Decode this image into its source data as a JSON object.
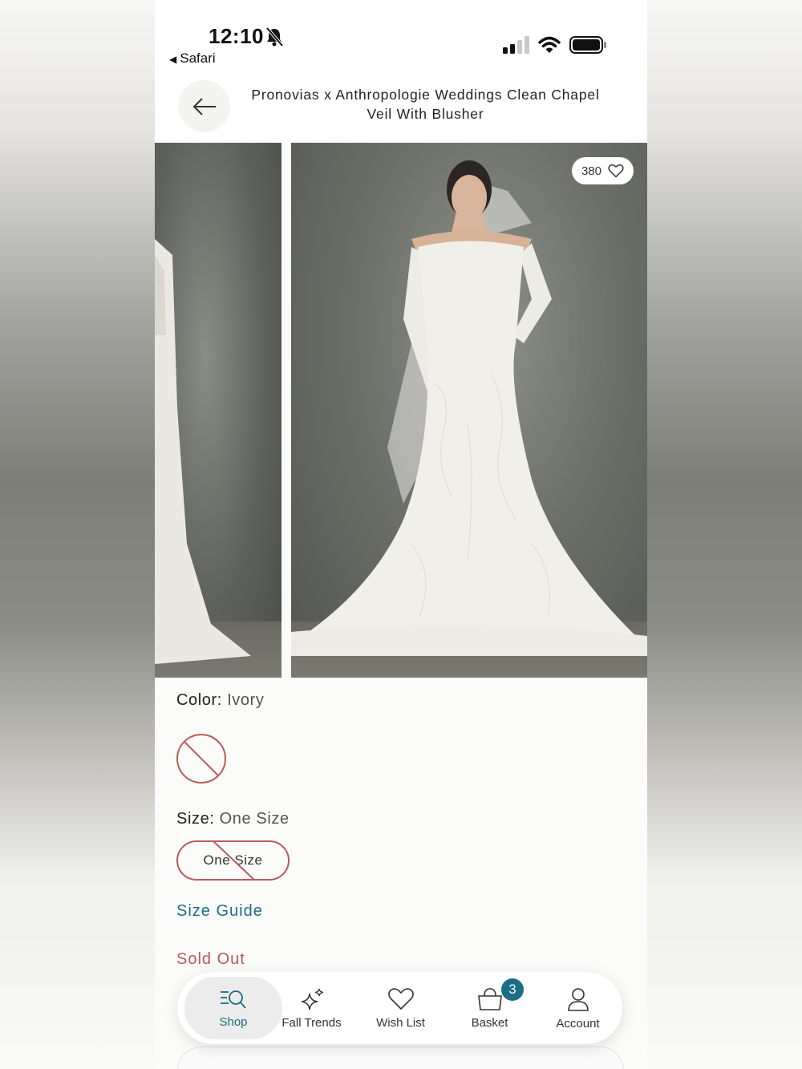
{
  "status_bar": {
    "time": "12:10",
    "back_app": "Safari"
  },
  "header": {
    "title": "Pronovias x Anthropologie Weddings Clean Chapel Veil With Blusher"
  },
  "gallery": {
    "likes": "380"
  },
  "product": {
    "color_label": "Color:",
    "color_value": "Ivory",
    "size_label": "Size:",
    "size_value": "One Size",
    "size_option": "One Size",
    "size_guide": "Size Guide",
    "availability": "Sold Out"
  },
  "tabbar": {
    "items": [
      {
        "label": "Shop",
        "icon": "search-list-icon"
      },
      {
        "label": "Fall Trends",
        "icon": "sparkles-icon"
      },
      {
        "label": "Wish List",
        "icon": "heart-icon"
      },
      {
        "label": "Basket",
        "icon": "basket-icon"
      },
      {
        "label": "Account",
        "icon": "person-icon"
      }
    ],
    "basket_count": "3"
  },
  "colors": {
    "accent": "#1b6e86",
    "sold_out": "#b55b5b"
  }
}
